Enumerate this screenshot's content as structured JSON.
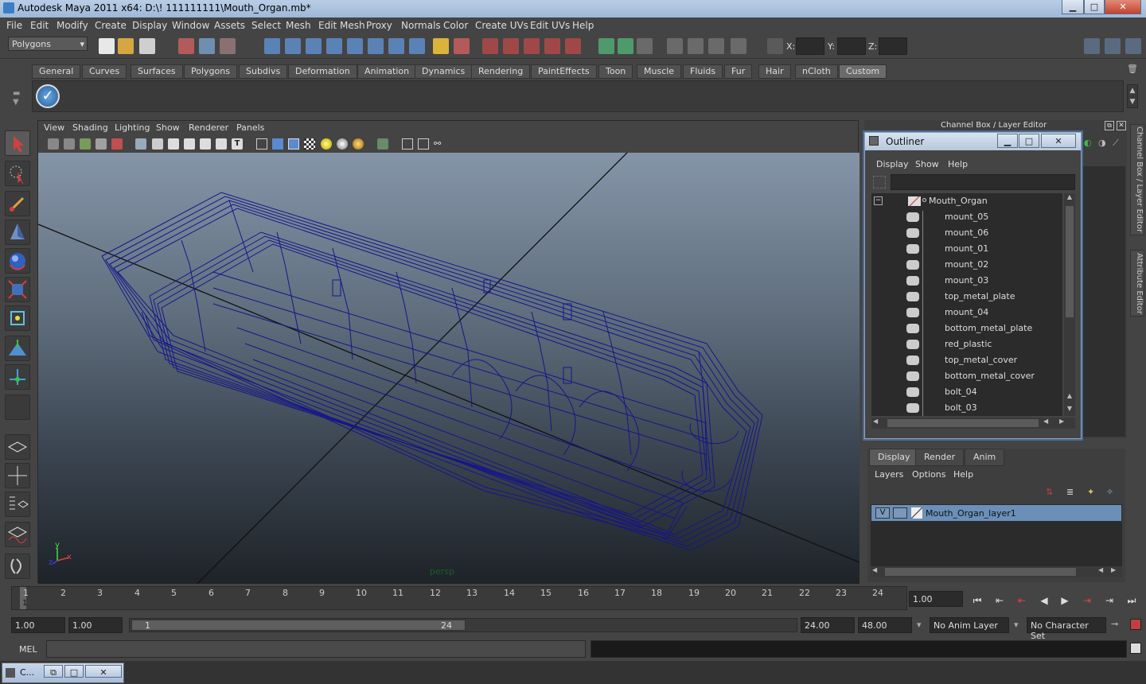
{
  "window": {
    "title": "Autodesk Maya 2011 x64: D:\\! 111111111\\Mouth_Organ.mb*",
    "min": "▁",
    "max": "□",
    "close": "✕"
  },
  "menubar": [
    "File",
    "Edit",
    "Modify",
    "Create",
    "Display",
    "Window",
    "Assets",
    "Select",
    "Mesh",
    "Edit Mesh",
    "Proxy",
    "Normals",
    "Color",
    "Create UVs",
    "Edit UVs",
    "Help"
  ],
  "statusline": {
    "mode": "Polygons",
    "x_label": "X:",
    "y_label": "Y:",
    "z_label": "Z:"
  },
  "shelf": {
    "tabs": [
      "General",
      "Curves",
      "Surfaces",
      "Polygons",
      "Subdivs",
      "Deformation",
      "Animation",
      "Dynamics",
      "Rendering",
      "PaintEffects",
      "Toon",
      "Muscle",
      "Fluids",
      "Fur",
      "Hair",
      "nCloth",
      "Custom"
    ],
    "active": "Custom"
  },
  "viewport": {
    "menus": [
      "View",
      "Shading",
      "Lighting",
      "Show",
      "Renderer",
      "Panels"
    ],
    "camera": "persp",
    "axis_x": "x",
    "axis_y": "y",
    "axis_z": "z",
    "wire_color": "#1a1a8c"
  },
  "channelbox": {
    "title": "Channel Box / Layer Editor"
  },
  "outliner": {
    "title": "Outliner",
    "menus": [
      "Display",
      "Show",
      "Help"
    ],
    "root": "Mouth_Organ",
    "items": [
      "mount_05",
      "mount_06",
      "mount_01",
      "mount_02",
      "mount_03",
      "top_metal_plate",
      "mount_04",
      "bottom_metal_plate",
      "red_plastic",
      "top_metal_cover",
      "bottom_metal_cover",
      "bolt_04",
      "bolt_03"
    ]
  },
  "sidetabs": [
    "Channel Box / Layer Editor",
    "Attribute Editor"
  ],
  "layers": {
    "tabs": [
      "Display",
      "Render",
      "Anim"
    ],
    "menus": [
      "Layers",
      "Options",
      "Help"
    ],
    "layer": {
      "visible": "V",
      "name": "Mouth_Organ_layer1"
    }
  },
  "timeline": {
    "ticks": [
      "1",
      "2",
      "3",
      "4",
      "5",
      "6",
      "7",
      "8",
      "9",
      "10",
      "11",
      "12",
      "13",
      "14",
      "15",
      "16",
      "17",
      "18",
      "19",
      "20",
      "21",
      "22",
      "23",
      "24"
    ],
    "current": "1",
    "current_field": "1.00"
  },
  "range": {
    "start": "1.00",
    "start2": "1.00",
    "slider_start": "1",
    "slider_end": "24",
    "end": "24.00",
    "end2": "48.00",
    "anim_layer": "No Anim Layer",
    "char_set": "No Character Set"
  },
  "cmd": {
    "label": "MEL"
  },
  "taskbar": {
    "label": "C..."
  }
}
